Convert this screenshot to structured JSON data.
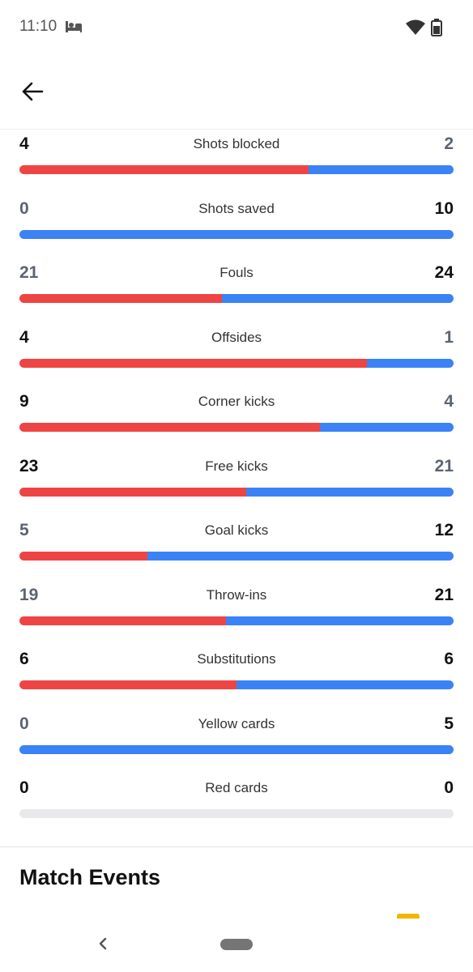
{
  "status_bar": {
    "time": "11:10"
  },
  "colors": {
    "home": "#ef4444",
    "away": "#3b82f6",
    "empty": "#e9e9ec",
    "muted_value": "#5b6470",
    "strong_value": "#111111"
  },
  "icons": {
    "back": "arrow-left",
    "bed": "bed",
    "wifi": "wifi",
    "battery": "battery",
    "nav_back": "chevron-left",
    "nav_home": "pill"
  },
  "stats": [
    {
      "label": "Shots blocked",
      "home": "4",
      "away": "2"
    },
    {
      "label": "Shots saved",
      "home": "0",
      "away": "10"
    },
    {
      "label": "Fouls",
      "home": "21",
      "away": "24"
    },
    {
      "label": "Offsides",
      "home": "4",
      "away": "1"
    },
    {
      "label": "Corner kicks",
      "home": "9",
      "away": "4"
    },
    {
      "label": "Free kicks",
      "home": "23",
      "away": "21"
    },
    {
      "label": "Goal kicks",
      "home": "5",
      "away": "12"
    },
    {
      "label": "Throw-ins",
      "home": "19",
      "away": "21"
    },
    {
      "label": "Substitutions",
      "home": "6",
      "away": "6"
    },
    {
      "label": "Yellow cards",
      "home": "0",
      "away": "5"
    },
    {
      "label": "Red cards",
      "home": "0",
      "away": "0"
    }
  ],
  "match_events": {
    "title": "Match Events"
  }
}
